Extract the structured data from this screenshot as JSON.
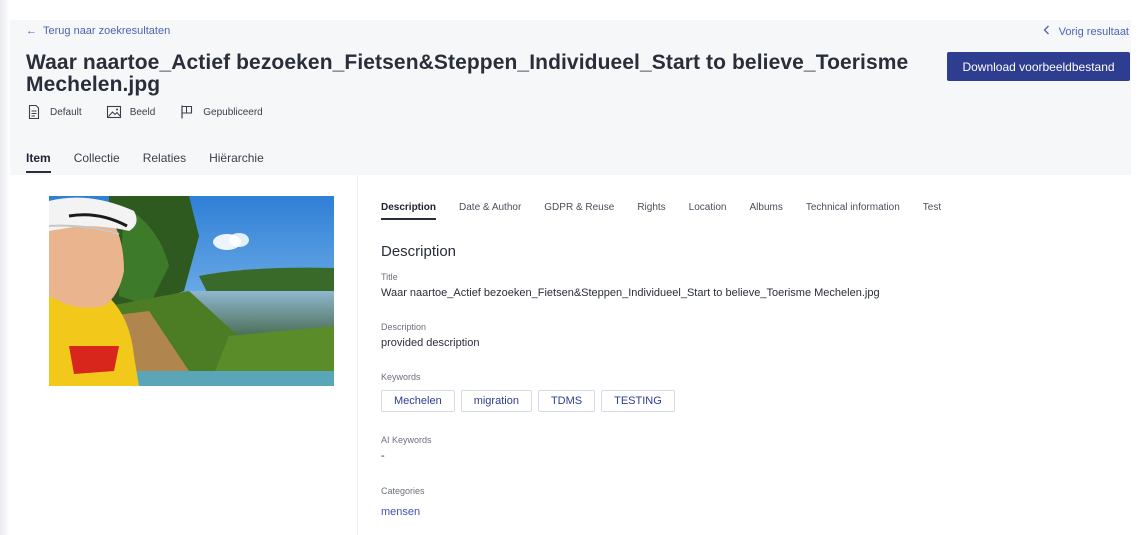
{
  "header": {
    "back_label": "Terug naar zoekresultaten",
    "prev_label": "Vorig resultaat",
    "title": "Waar naartoe_Actief bezoeken_Fietsen&Steppen_Individueel_Start to believe_Toerisme Mechelen.jpg",
    "download_label": "Download voorbeeldbestand",
    "meta": [
      {
        "icon": "document-icon",
        "label": "Default"
      },
      {
        "icon": "image-icon",
        "label": "Beeld"
      },
      {
        "icon": "flag-icon",
        "label": "Gepubliceerd"
      }
    ]
  },
  "tabs": [
    {
      "label": "Item",
      "active": true
    },
    {
      "label": "Collectie",
      "active": false
    },
    {
      "label": "Relaties",
      "active": false
    },
    {
      "label": "Hiërarchie",
      "active": false
    }
  ],
  "detail": {
    "subtabs": [
      {
        "label": "Description",
        "active": true
      },
      {
        "label": "Date & Author",
        "active": false
      },
      {
        "label": "GDPR & Reuse",
        "active": false
      },
      {
        "label": "Rights",
        "active": false
      },
      {
        "label": "Location",
        "active": false
      },
      {
        "label": "Albums",
        "active": false
      },
      {
        "label": "Technical information",
        "active": false
      },
      {
        "label": "Test",
        "active": false
      }
    ],
    "section_title": "Description",
    "fields": {
      "title_label": "Title",
      "title_value": "Waar naartoe_Actief bezoeken_Fietsen&Steppen_Individueel_Start to believe_Toerisme Mechelen.jpg",
      "description_label": "Description",
      "description_value": "provided description",
      "keywords_label": "Keywords",
      "keywords": [
        "Mechelen",
        "migration",
        "TDMS",
        "TESTING"
      ],
      "ai_keywords_label": "AI Keywords",
      "ai_keywords_value": "-",
      "categories_label": "Categories",
      "category_value": "mensen"
    }
  },
  "colors": {
    "accent": "#2d3d8f",
    "link": "#4f63b4",
    "header_bg": "#f6f7f9"
  }
}
